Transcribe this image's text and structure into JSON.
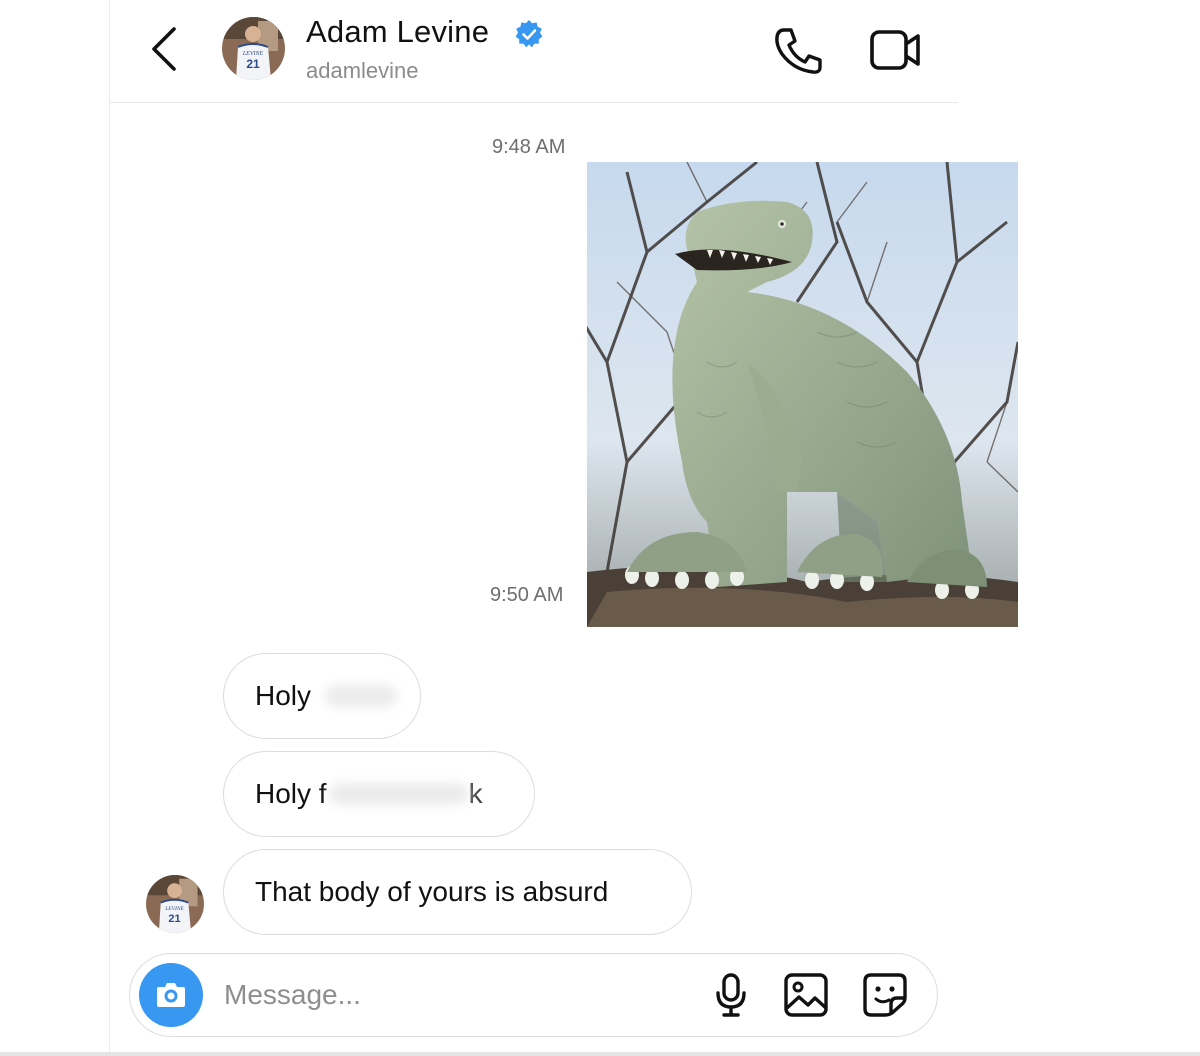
{
  "header": {
    "name": "Adam Levine",
    "username": "adamlevine",
    "verified": true,
    "avatar_jersey_text": "LEVINE",
    "avatar_jersey_number": "21",
    "accent_color": "#3897f0"
  },
  "thread": {
    "timestamps": [
      "9:48 AM",
      "9:50 AM"
    ],
    "sent_photo_subject": "dinosaur statue",
    "messages": [
      {
        "visible_text": "Holy",
        "censored": true
      },
      {
        "visible_text": "Holy f",
        "censored": true,
        "tail": "k"
      },
      {
        "visible_text": "That body of yours is absurd",
        "censored": false
      }
    ]
  },
  "composer": {
    "placeholder": "Message...",
    "value": "",
    "camera_color": "#3897f0"
  },
  "icons": [
    "back-chevron-icon",
    "verified-badge-icon",
    "phone-icon",
    "video-camera-icon",
    "camera-icon",
    "microphone-icon",
    "gallery-icon",
    "sticker-icon"
  ]
}
